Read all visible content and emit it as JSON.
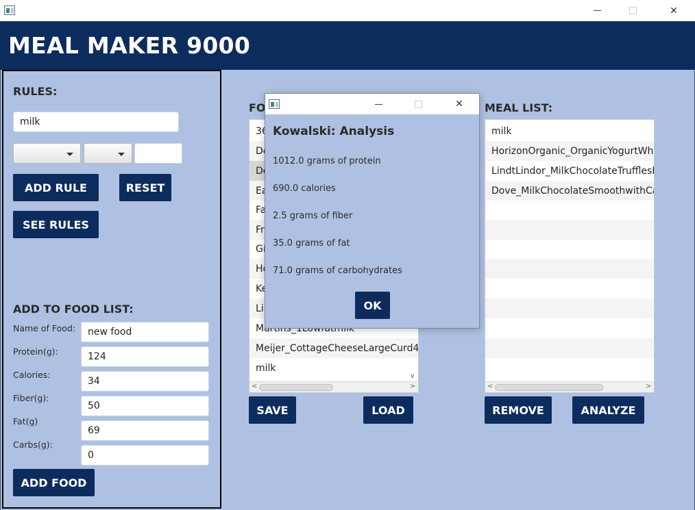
{
  "window": {
    "minimize_icon": "minimize-icon",
    "maximize_icon": "maximize-icon",
    "close_glyph": "✕"
  },
  "header": {
    "title": "MEAL MAKER 9000"
  },
  "rules": {
    "heading": "RULES:",
    "input_value": "milk",
    "add_rule_label": "ADD RULE",
    "reset_label": "RESET",
    "see_rules_label": "SEE RULES"
  },
  "add_food": {
    "heading": "ADD TO FOOD LIST:",
    "fields": [
      {
        "label": "Name of Food:",
        "value": "new food"
      },
      {
        "label": "Protein(g):",
        "value": "124"
      },
      {
        "label": "Calories:",
        "value": "34"
      },
      {
        "label": "Fiber(g):",
        "value": "50"
      },
      {
        "label": "Fat(g)",
        "value": "69"
      },
      {
        "label": "Carbs(g):",
        "value": "0"
      }
    ],
    "add_food_label": "ADD FOOD"
  },
  "food_list": {
    "heading": "FO",
    "items": [
      "36",
      "De",
      "Do",
      "Ea",
      "Fa",
      "Fr",
      "Gi",
      "Ho",
      "Ke",
      "Lin",
      "Martins_1Lowfatmilk",
      "Meijer_CottageCheeseLargeCurd4",
      "milk"
    ],
    "save_label": "SAVE",
    "load_label": "LOAD"
  },
  "meal_list": {
    "heading": "MEAL LIST:",
    "items": [
      "milk",
      "HorizonOrganic_OrganicYogurtWho",
      "LindtLindor_MilkChocolateTrufflesM",
      "Dove_MilkChocolateSmoothwithCar"
    ],
    "remove_label": "REMOVE",
    "analyze_label": "ANALYZE"
  },
  "dialog": {
    "title": "Kowalski: Analysis",
    "lines": [
      "1012.0 grams of protein",
      "690.0 calories",
      "2.5 grams of fiber",
      "35.0 grams of fat",
      "71.0 grams of carbohydrates"
    ],
    "ok_label": "OK"
  }
}
